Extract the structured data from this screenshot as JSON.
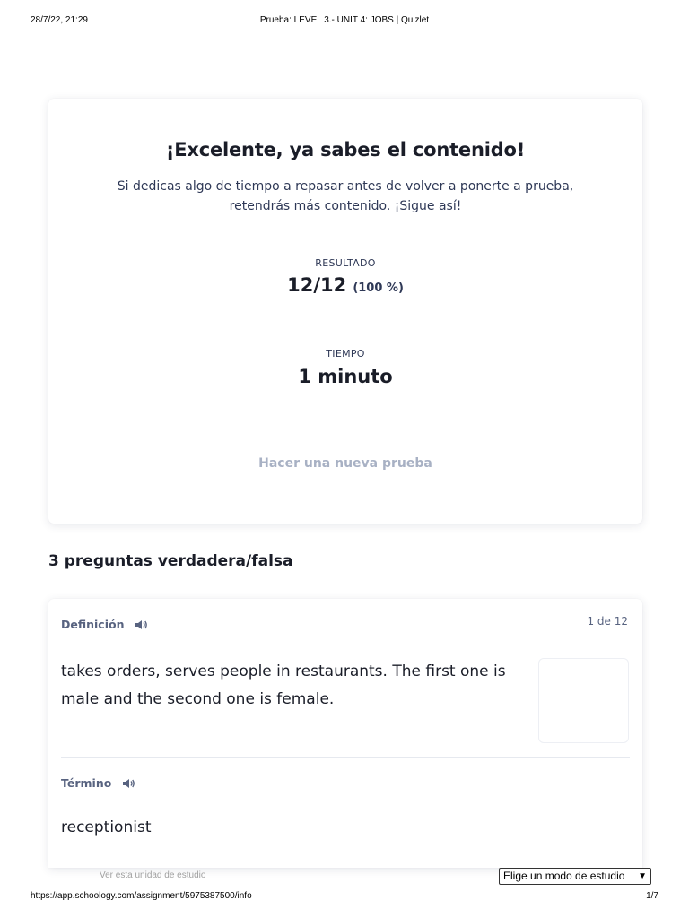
{
  "print_header": {
    "datetime": "28/7/22, 21:29",
    "title": "Prueba: LEVEL 3.- UNIT 4: JOBS | Quizlet"
  },
  "result": {
    "title": "¡Excelente, ya sabes el contenido!",
    "subtitle_line1": "Si dedicas algo de tiempo a repasar antes de volver a ponerte a prueba,",
    "subtitle_line2": "retendrás más contenido. ¡Sigue así!",
    "score_label": "RESULTADO",
    "score": "12/12",
    "score_percent": "(100 %)",
    "time_label": "TIEMPO",
    "time_value": "1 minuto",
    "retry_label": "Hacer una nueva prueba"
  },
  "section": {
    "heading": "3 preguntas verdadera/falsa"
  },
  "question": {
    "definition_label": "Definición",
    "counter": "1 de 12",
    "definition_text": "takes orders, serves people in restaurants. The first one is male and the second one is female.",
    "term_label": "Término",
    "term_text": "receptionist"
  },
  "footer": {
    "study_link": "Ver esta unidad de estudio",
    "mode_select_value": "Elige un modo de estudio"
  },
  "print_footer": {
    "url": "https://app.schoology.com/assignment/5975387500/info",
    "page": "1/7"
  },
  "icons": {
    "speaker": "speaker-icon",
    "dropdown": "chevron-down-icon"
  }
}
